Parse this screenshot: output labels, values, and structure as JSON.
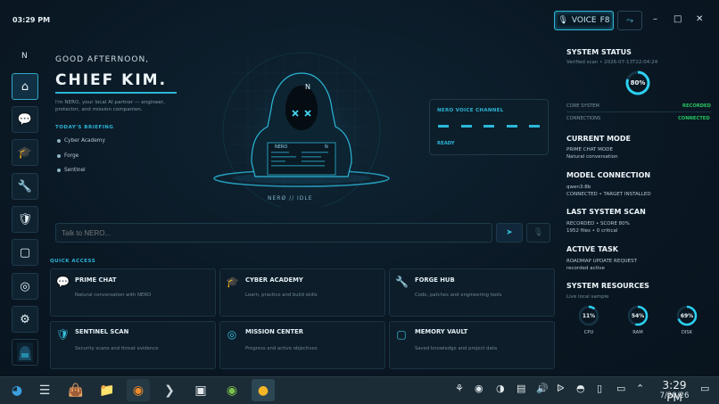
{
  "header": {
    "time": "03:29 PM",
    "voice_label": "VOICE",
    "voice_key": "F8",
    "wave_glyph": "⤳",
    "minimize": "–",
    "maximize": "□",
    "close": "✕"
  },
  "sidebar": {
    "letter": "N",
    "items": [
      {
        "icon": "home-icon",
        "active": true
      },
      {
        "icon": "chat-icon"
      },
      {
        "icon": "graduation-cap-icon"
      },
      {
        "icon": "tools-icon"
      },
      {
        "icon": "shield-icon"
      },
      {
        "icon": "cube-icon"
      },
      {
        "icon": "target-icon"
      },
      {
        "icon": "gear-icon"
      },
      {
        "icon": "avatar-thumbnail"
      }
    ]
  },
  "main": {
    "greeting": "GOOD AFTERNOON,",
    "name": "CHIEF KIM.",
    "intro": "I'm NERO, your local AI partner — engineer, protector, and mission companion.",
    "briefing_title": "TODAY'S BRIEFING",
    "briefing": [
      "Cyber Academy",
      "Forge",
      "Sentinel"
    ],
    "hero_badge": "N",
    "hero_screen": "NERO",
    "hero_status": "NERØ // IDLE",
    "voice_channel": {
      "title": "NERO VOICE CHANNEL",
      "status": "READY"
    },
    "chat_placeholder": "Talk to NERO...",
    "quick_access_title": "QUICK ACCESS",
    "quick_access": [
      {
        "title": "PRIME CHAT",
        "desc": "Natural conversation with NERO",
        "icon": "chat-bubble-icon"
      },
      {
        "title": "CYBER ACADEMY",
        "desc": "Learn, practice and build skills",
        "icon": "graduation-cap-icon"
      },
      {
        "title": "FORGE HUB",
        "desc": "Code, patches and engineering tools",
        "icon": "tools-icon"
      },
      {
        "title": "SENTINEL SCAN",
        "desc": "Security scans and threat evidence",
        "icon": "shield-icon"
      },
      {
        "title": "MISSION CENTER",
        "desc": "Progress and active objectives",
        "icon": "target-icon"
      },
      {
        "title": "MEMORY VAULT",
        "desc": "Saved knowledge and project data",
        "icon": "cube-icon"
      }
    ]
  },
  "status": {
    "title": "SYSTEM STATUS",
    "verified": "Verified scan • 2026-07-13T22:04:24",
    "score_percent": 80,
    "score_label": "80%",
    "core_label": "CORE SYSTEM",
    "core_value": "RECORDED",
    "conn_label": "CONNECTIONS",
    "conn_value": "CONNECTED",
    "mode_title": "CURRENT MODE",
    "mode_line1": "PRIME CHAT MODE",
    "mode_line2": "Natural conversation",
    "model_title": "MODEL CONNECTION",
    "model_line1": "qwen3:8b",
    "model_line2": "CONNECTED • TARGET INSTALLED",
    "scan_title": "LAST SYSTEM SCAN",
    "scan_line1": "RECORDED • SCORE 80%",
    "scan_line2": "1952 files • 0 critical",
    "task_title": "ACTIVE TASK",
    "task_line1": "ROADMAP UPDATE REQUEST",
    "task_line2": "recorded active",
    "res_title": "SYSTEM RESOURCES",
    "res_sub": "Live local sample",
    "resources": [
      {
        "label": "CPU",
        "value": "11%",
        "percent": 11
      },
      {
        "label": "RAM",
        "value": "54%",
        "percent": 54
      },
      {
        "label": "DISK",
        "value": "69%",
        "percent": 69
      }
    ]
  },
  "taskbar": {
    "clock": "3:29 PM",
    "date": "7/20/26"
  },
  "colors": {
    "accent": "#2bb7d8",
    "ok": "#27c25e",
    "bg": "#0a1824"
  }
}
